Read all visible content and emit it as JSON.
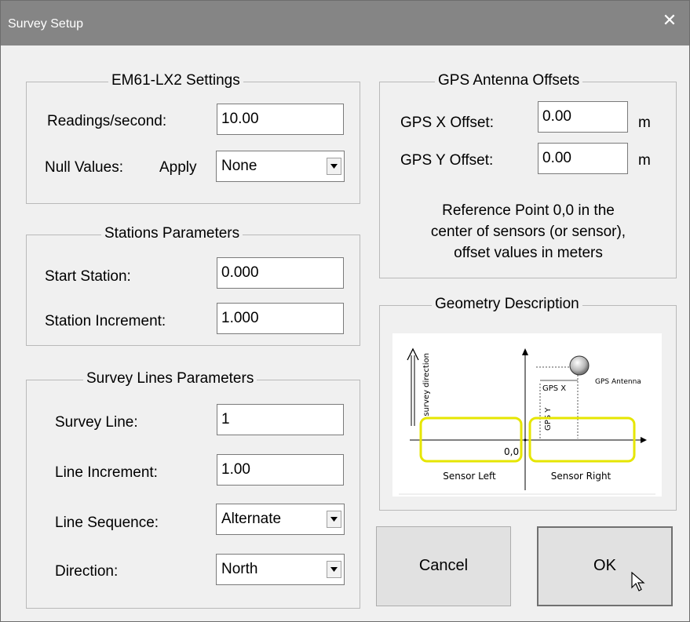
{
  "window": {
    "title": "Survey Setup",
    "close_icon": "close-icon"
  },
  "em61": {
    "legend": "EM61-LX2 Settings",
    "readings_label": "Readings/second:",
    "readings_value": "10.00",
    "null_label": "Null Values:",
    "apply_label": "Apply",
    "null_option": "None"
  },
  "stations": {
    "legend": "Stations Parameters",
    "start_label": "Start Station:",
    "start_value": "0.000",
    "increment_label": "Station Increment:",
    "increment_value": "1.000"
  },
  "lines": {
    "legend": "Survey Lines Parameters",
    "survey_line_label": "Survey Line:",
    "survey_line_value": "1",
    "line_increment_label": "Line Increment:",
    "line_increment_value": "1.00",
    "sequence_label": "Line Sequence:",
    "sequence_option": "Alternate",
    "direction_label": "Direction:",
    "direction_option": "North"
  },
  "gps": {
    "legend": "GPS Antenna Offsets",
    "x_label": "GPS X Offset:",
    "x_value": "0.00",
    "x_unit": "m",
    "y_label": "GPS Y Offset:",
    "y_value": "0.00",
    "y_unit": "m",
    "note_line1": "Reference Point 0,0 in the",
    "note_line2": "center of sensors (or sensor),",
    "note_line3": "offset values in meters"
  },
  "geometry": {
    "legend": "Geometry Description",
    "survey_direction": "survey direction",
    "gps_x": "GPS X",
    "gps_y": "GPS Y",
    "gps_antenna": "GPS Antenna",
    "origin": "0,0",
    "sensor_left": "Sensor Left",
    "sensor_right": "Sensor Right",
    "sensor_color": "#e6e600"
  },
  "buttons": {
    "cancel": "Cancel",
    "ok": "OK"
  }
}
